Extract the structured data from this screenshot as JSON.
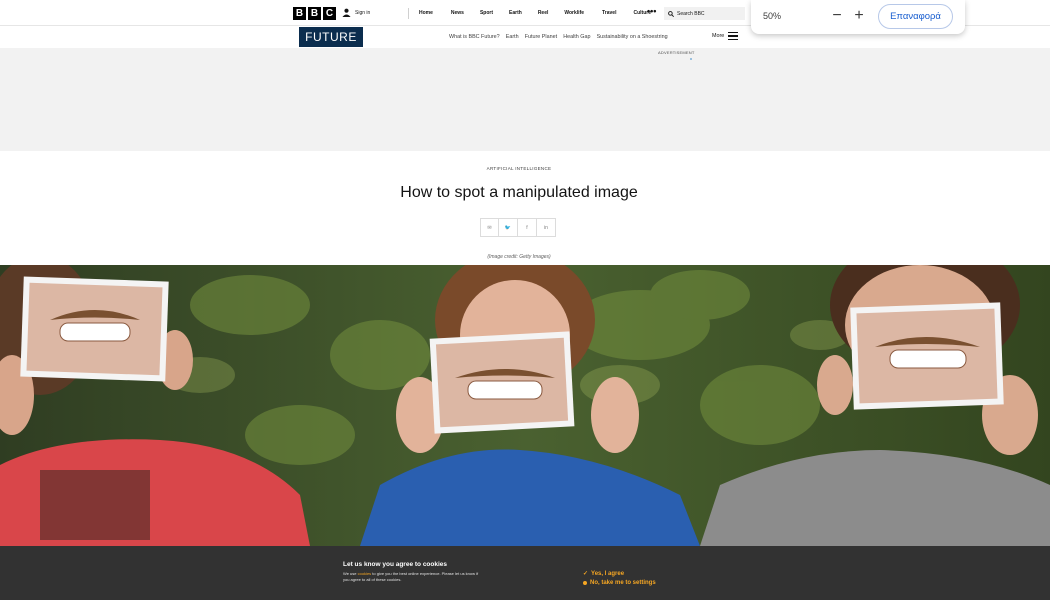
{
  "global_nav": {
    "logo_letters": [
      "B",
      "B",
      "C"
    ],
    "sign_in": "Sign in",
    "links": [
      "Home",
      "News",
      "Sport",
      "Earth",
      "Reel",
      "Worklife",
      "Travel",
      "Culture"
    ],
    "more": "•••",
    "search_placeholder": "Search BBC"
  },
  "future_nav": {
    "logo": "FUTURE",
    "links": [
      "What is BBC Future?",
      "Earth",
      "Future Planet",
      "Health Gap",
      "Sustainability on a Shoestring"
    ],
    "more": "More"
  },
  "ad": {
    "label": "ADVERTISEMENT"
  },
  "article": {
    "kicker": "ARTIFICIAL INTELLIGENCE",
    "headline": "How to spot a manipulated image",
    "share": [
      "✉",
      "🐦",
      "f",
      "in"
    ],
    "image_credit": "(Image credit: Getty Images)"
  },
  "cookie": {
    "title": "Let us know you agree to cookies",
    "text_before": "We use ",
    "link": "cookies",
    "text_after": " to give you the best online experience. Please let us know if you agree to all of these cookies.",
    "agree": "Yes, I agree",
    "settings": "No, take me to settings"
  },
  "zoom": {
    "level": "50%",
    "minus": "−",
    "plus": "+",
    "reset": "Επαναφορά"
  },
  "colors": {
    "future_blue": "#0b2d4e",
    "cookie_bg": "#323232",
    "cookie_accent": "#f5a623",
    "zoom_reset_text": "#1a5fd0"
  }
}
